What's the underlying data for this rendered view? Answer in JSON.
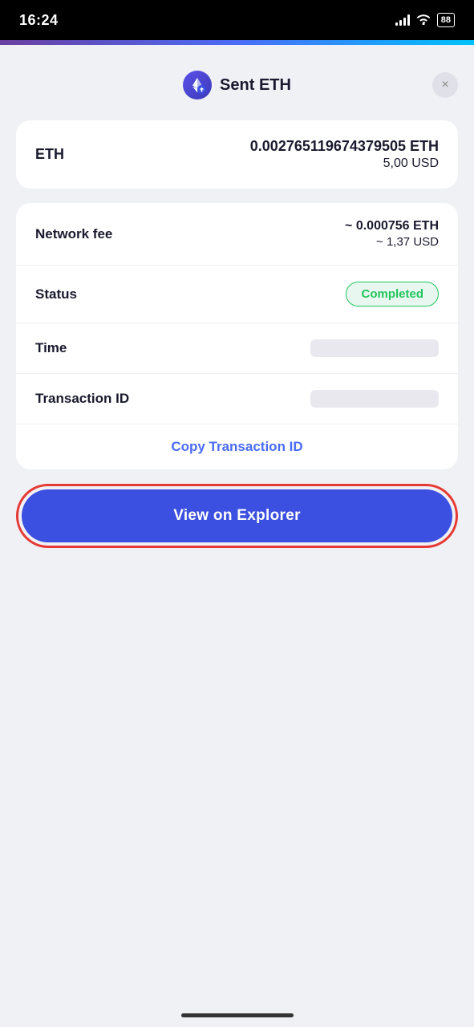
{
  "statusBar": {
    "time": "16:24",
    "battery": "88"
  },
  "header": {
    "title": "Sent ETH",
    "closeLabel": "×"
  },
  "amountCard": {
    "label": "ETH",
    "ethAmount": "0.00276511 9674379505 ETH",
    "usdAmount": "5,00 USD"
  },
  "detailsCard": {
    "networkFeeLabel": "Network fee",
    "networkFeeEth": "~ 0.000756 ETH",
    "networkFeeUsd": "~ 1,37 USD",
    "statusLabel": "Status",
    "statusValue": "Completed",
    "timeLabel": "Time",
    "transactionIdLabel": "Transaction ID",
    "copyLinkLabel": "Copy Transaction ID"
  },
  "explorerButton": {
    "label": "View on Explorer"
  },
  "colors": {
    "accent": "#3B4FE0",
    "statusGreen": "#22c55e",
    "highlight": "#e53935"
  }
}
